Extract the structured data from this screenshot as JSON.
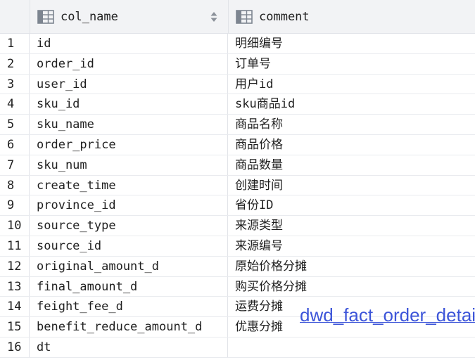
{
  "header": {
    "col1_label": "col_name",
    "col2_label": "comment",
    "col_icon": "table-column-icon",
    "sort_icon": "sort-updown-icon"
  },
  "rows": [
    {
      "num": "1",
      "col_name": "id",
      "comment": "明细编号"
    },
    {
      "num": "2",
      "col_name": "order_id",
      "comment": "订单号"
    },
    {
      "num": "3",
      "col_name": "user_id",
      "comment": "用户id"
    },
    {
      "num": "4",
      "col_name": "sku_id",
      "comment": "sku商品id"
    },
    {
      "num": "5",
      "col_name": "sku_name",
      "comment": "商品名称"
    },
    {
      "num": "6",
      "col_name": "order_price",
      "comment": "商品价格"
    },
    {
      "num": "7",
      "col_name": "sku_num",
      "comment": "商品数量"
    },
    {
      "num": "8",
      "col_name": "create_time",
      "comment": "创建时间"
    },
    {
      "num": "9",
      "col_name": "province_id",
      "comment": "省份ID"
    },
    {
      "num": "10",
      "col_name": "source_type",
      "comment": "来源类型"
    },
    {
      "num": "11",
      "col_name": "source_id",
      "comment": "来源编号"
    },
    {
      "num": "12",
      "col_name": "original_amount_d",
      "comment": "原始价格分摊"
    },
    {
      "num": "13",
      "col_name": "final_amount_d",
      "comment": "购买价格分摊"
    },
    {
      "num": "14",
      "col_name": "feight_fee_d",
      "comment": "运费分摊"
    },
    {
      "num": "15",
      "col_name": "benefit_reduce_amount_d",
      "comment": "优惠分摊"
    },
    {
      "num": "16",
      "col_name": "dt",
      "comment": ""
    }
  ],
  "overlay_label": "dwd_fact_order_detail",
  "colors": {
    "header_bg": "#f2f3f5",
    "grid_line": "#e1e3e8",
    "overlay_text": "#3d55d9"
  }
}
